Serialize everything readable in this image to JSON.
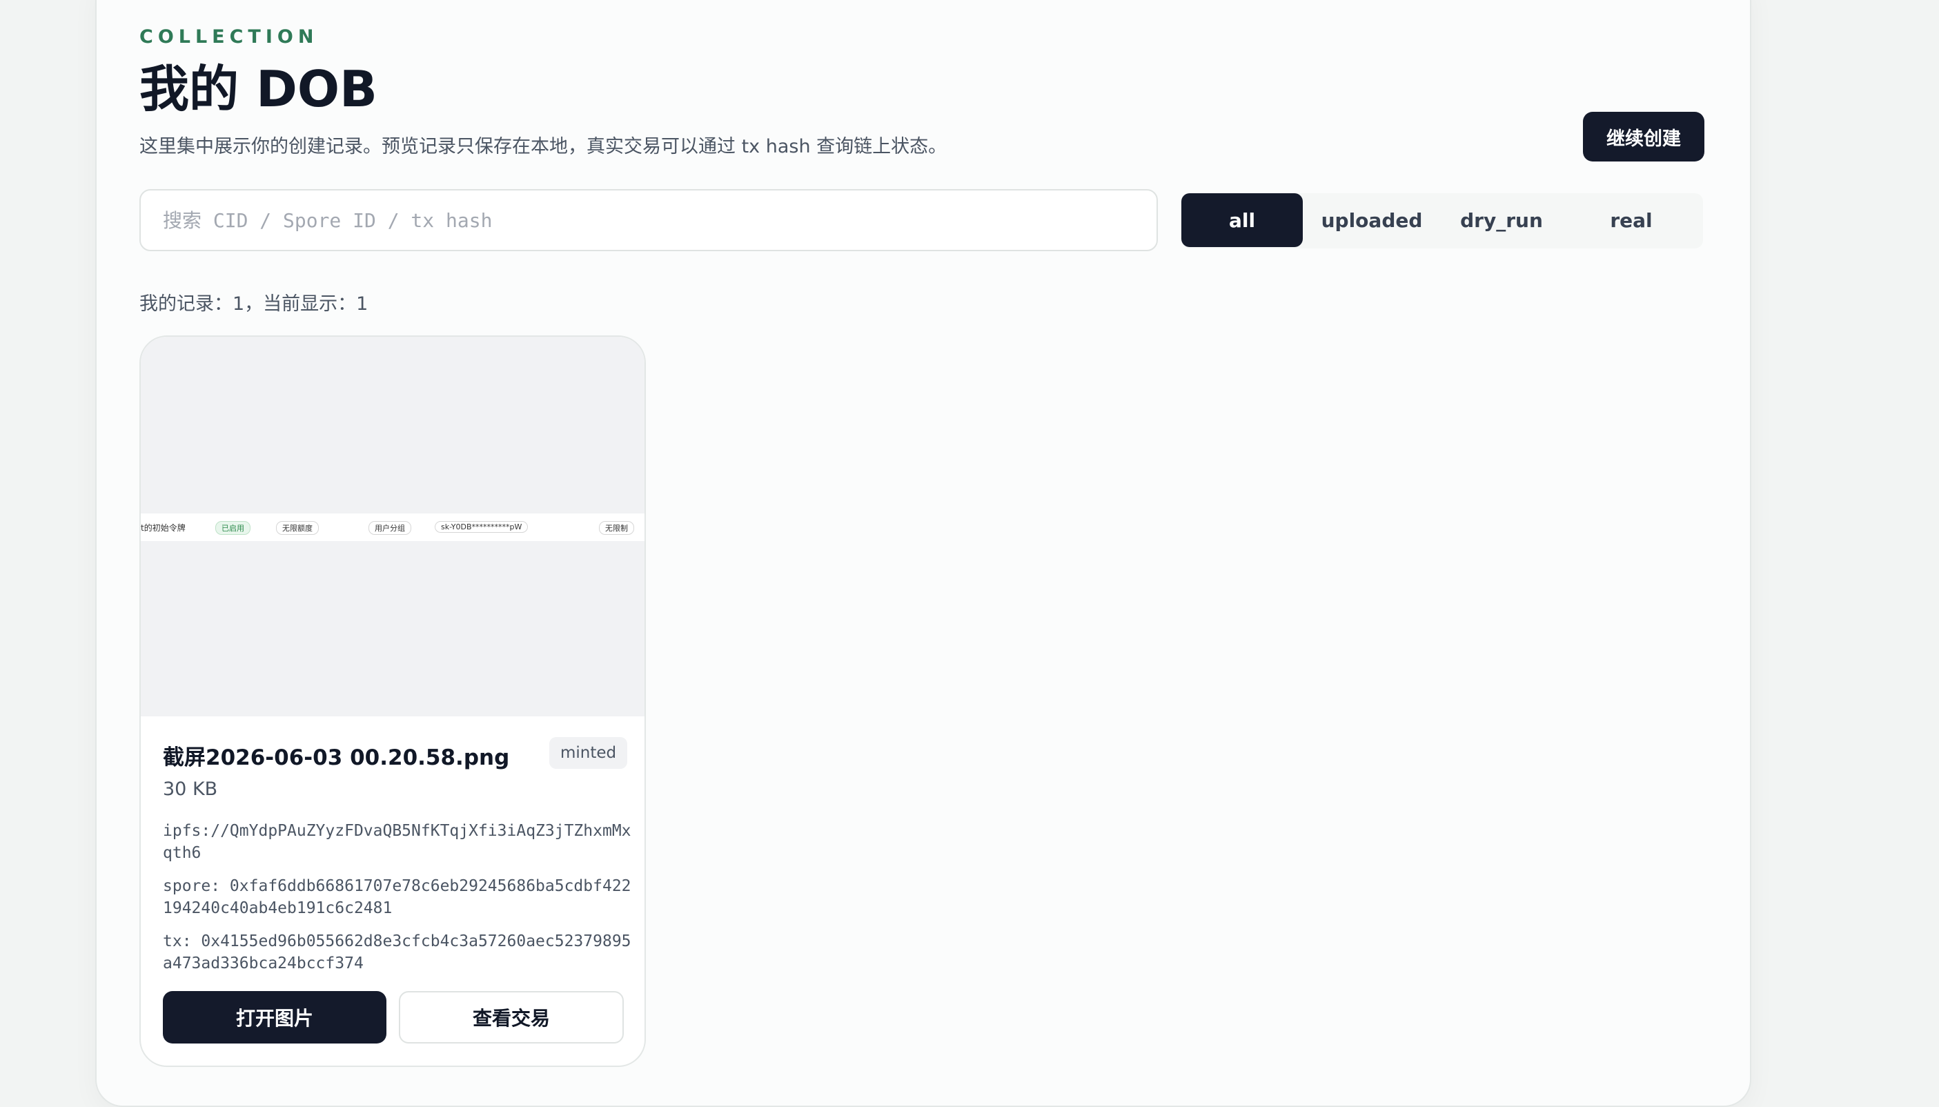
{
  "header": {
    "eyebrow": "COLLECTION",
    "title": "我的 DOB",
    "subtitle": "这里集中展示你的创建记录。预览记录只保存在本地，真实交易可以通过 tx hash 查询链上状态。",
    "continue_label": "继续创建"
  },
  "search": {
    "placeholder": "搜索 CID / Spore ID / tx hash",
    "value": ""
  },
  "filters": [
    {
      "label": "all",
      "active": true
    },
    {
      "label": "uploaded",
      "active": false
    },
    {
      "label": "dry_run",
      "active": false
    },
    {
      "label": "real",
      "active": false
    }
  ],
  "record_count": "我的记录：1，当前显示：1",
  "records": [
    {
      "name": "截屏2026-06-03 00.20.58.png",
      "status": "minted",
      "size": "30 KB",
      "cid": "ipfs://QmYdpPAuZYyzFDvaQB5NfKTqjXfi3iAqZ3jTZhxmMxqth6",
      "spore": "spore: 0xfaf6ddb66861707e78c6eb29245686ba5cdbf422194240c40ab4eb191c6c2481",
      "tx": "tx: 0x4155ed96b055662d8e3cfcb4c3a57260aec52379895a473ad336bca24bccf374",
      "open_label": "打开图片",
      "view_tx_label": "查看交易",
      "preview": {
        "token_name": "t的初始令牌",
        "enabled": "已启用",
        "quota": "无限额度",
        "group": "用户分组",
        "key": "sk-Y0DB**********pW",
        "limit": "无限制"
      }
    }
  ],
  "colors": {
    "accent": "#2f7a57",
    "primary": "#141a2b",
    "panel": "#fbfcfc"
  }
}
